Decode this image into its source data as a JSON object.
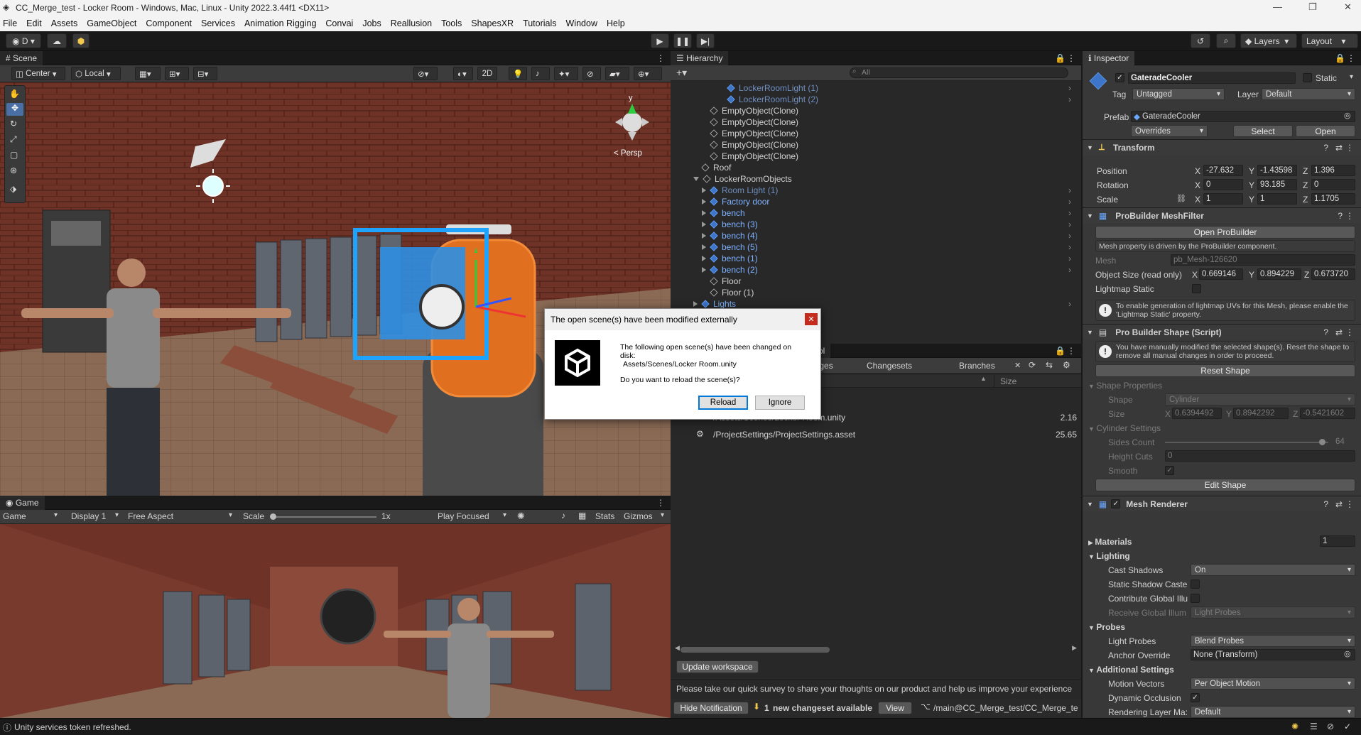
{
  "window": {
    "title": "CC_Merge_test - Locker Room - Windows, Mac, Linux - Unity 2022.3.44f1 <DX11>"
  },
  "menu": [
    "File",
    "Edit",
    "Assets",
    "GameObject",
    "Component",
    "Services",
    "Animation Rigging",
    "Convai",
    "Jobs",
    "Reallusion",
    "Tools",
    "ShapesXR",
    "Tutorials",
    "Window",
    "Help"
  ],
  "toolbar": {
    "account": "D",
    "layers": "Layers",
    "layout": "Layout"
  },
  "scene": {
    "tab": "Scene",
    "pivot": "Center",
    "space": "Local",
    "mode_2d": "2D",
    "persp": "< Persp",
    "gizmo_y": "y"
  },
  "game": {
    "tab": "Game",
    "view": "Game",
    "display": "Display 1",
    "aspect": "Free Aspect",
    "scale_label": "Scale",
    "scale_value": "1x",
    "play_mode": "Play Focused",
    "stats": "Stats",
    "gizmos": "Gizmos"
  },
  "hierarchy": {
    "tab": "Hierarchy",
    "search_placeholder": "All",
    "rows": [
      {
        "label": "LockerRoomLight (1)",
        "indent": 4,
        "style": "dim",
        "arrow": "",
        "icon": "prefab"
      },
      {
        "label": "LockerRoomLight (2)",
        "indent": 4,
        "style": "dim",
        "arrow": "",
        "icon": "prefab"
      },
      {
        "label": "EmptyObject(Clone)",
        "indent": 2,
        "style": "",
        "arrow": "",
        "icon": "object"
      },
      {
        "label": "EmptyObject(Clone)",
        "indent": 2,
        "style": "",
        "arrow": "",
        "icon": "object"
      },
      {
        "label": "EmptyObject(Clone)",
        "indent": 2,
        "style": "",
        "arrow": "",
        "icon": "object"
      },
      {
        "label": "EmptyObject(Clone)",
        "indent": 2,
        "style": "",
        "arrow": "",
        "icon": "object"
      },
      {
        "label": "EmptyObject(Clone)",
        "indent": 2,
        "style": "",
        "arrow": "",
        "icon": "object"
      },
      {
        "label": "Roof",
        "indent": 1,
        "style": "",
        "arrow": "",
        "icon": "object"
      },
      {
        "label": "LockerRoomObjects",
        "indent": 1,
        "style": "",
        "arrow": "down",
        "icon": "object"
      },
      {
        "label": "Room Light (1)",
        "indent": 2,
        "style": "dim",
        "arrow": "right",
        "icon": "prefab"
      },
      {
        "label": "Factory door",
        "indent": 2,
        "style": "blue",
        "arrow": "right",
        "icon": "prefab"
      },
      {
        "label": "bench",
        "indent": 2,
        "style": "blue",
        "arrow": "right",
        "icon": "prefab"
      },
      {
        "label": "bench (3)",
        "indent": 2,
        "style": "blue",
        "arrow": "right",
        "icon": "prefab"
      },
      {
        "label": "bench (4)",
        "indent": 2,
        "style": "blue",
        "arrow": "right",
        "icon": "prefab"
      },
      {
        "label": "bench (5)",
        "indent": 2,
        "style": "blue",
        "arrow": "right",
        "icon": "prefab"
      },
      {
        "label": "bench (1)",
        "indent": 2,
        "style": "blue",
        "arrow": "right",
        "icon": "prefab"
      },
      {
        "label": "bench (2)",
        "indent": 2,
        "style": "blue",
        "arrow": "right",
        "icon": "prefab"
      },
      {
        "label": "Floor",
        "indent": 2,
        "style": "",
        "arrow": "",
        "icon": "object"
      },
      {
        "label": "Floor (1)",
        "indent": 2,
        "style": "",
        "arrow": "",
        "icon": "object"
      },
      {
        "label": "Lights",
        "indent": 1,
        "style": "blue",
        "arrow": "right",
        "icon": "prefab"
      }
    ]
  },
  "plastic": {
    "tab_partial": "rol",
    "tabs": [
      "anges",
      "Changesets",
      "Branches"
    ],
    "col_size": "Size",
    "files": [
      {
        "path": "/Assets/Scenes/Locker Room.unity",
        "size": "2.16"
      },
      {
        "path": "/ProjectSettings/ProjectSettings.asset",
        "size": "25.65"
      }
    ],
    "update_button": "Update workspace",
    "survey": "Please take our quick survey to share your thoughts on our product and help us improve your experience",
    "hide_notification": "Hide Notification",
    "changeset_count": "1",
    "changeset_text": "new changeset available",
    "view_button": "View",
    "branch": "/main@CC_Merge_test/CC_Merge_te"
  },
  "inspector": {
    "tab": "Inspector",
    "object_name": "GateradeCooler",
    "static_label": "Static",
    "tag_label": "Tag",
    "tag": "Untagged",
    "layer_label": "Layer",
    "layer": "Default",
    "prefab_label": "Prefab",
    "prefab": "GateradeCooler",
    "overrides": "Overrides",
    "select": "Select",
    "open": "Open",
    "transform": {
      "title": "Transform",
      "position_label": "Position",
      "position": {
        "x": "-27.632",
        "y": "-1.43598",
        "z": "1.396"
      },
      "rotation_label": "Rotation",
      "rotation": {
        "x": "0",
        "y": "93.185",
        "z": "0"
      },
      "scale_label": "Scale",
      "scale": {
        "x": "1",
        "y": "1",
        "z": "1.1705"
      }
    },
    "meshfilter": {
      "title": "ProBuilder MeshFilter",
      "open_button": "Open ProBuilder",
      "note": "Mesh property is driven by the ProBuilder component.",
      "mesh_label": "Mesh",
      "mesh": "pb_Mesh-126620",
      "size_label": "Object Size (read only)",
      "size": {
        "x": "0.669146",
        "y": "0.894229",
        "z": "0.673720"
      },
      "lightmap_label": "Lightmap Static",
      "info": "To enable generation of lightmap UVs for this Mesh, please enable the 'Lightmap Static' property."
    },
    "shape": {
      "title": "Pro Builder Shape (Script)",
      "info": "You have manually modified the selected shape(s). Reset the shape to remove all manual changes in order to proceed.",
      "reset_button": "Reset Shape",
      "props_label": "Shape Properties",
      "shape_label": "Shape",
      "shape": "Cylinder",
      "size_label": "Size",
      "size": {
        "x": "0.6394492",
        "y": "0.8942292",
        "z": "-0.5421602"
      },
      "cyl_label": "Cylinder Settings",
      "sides_label": "Sides Count",
      "sides": "64",
      "sides_fraction": 0.98,
      "height_cuts_label": "Height Cuts",
      "height_cuts": "0",
      "smooth_label": "Smooth",
      "edit_button": "Edit Shape"
    },
    "renderer": {
      "title": "Mesh Renderer",
      "materials_label": "Materials",
      "materials_count": "1",
      "lighting_label": "Lighting",
      "cast_shadows_label": "Cast Shadows",
      "cast_shadows": "On",
      "static_shadow_label": "Static Shadow Caste",
      "contribute_gi_label": "Contribute Global Illu",
      "receive_gi_label": "Receive Global Illum",
      "receive_gi": "Light Probes",
      "probes_label": "Probes",
      "light_probes_label": "Light Probes",
      "light_probes": "Blend Probes",
      "anchor_label": "Anchor Override",
      "anchor": "None (Transform)",
      "additional_label": "Additional Settings",
      "motion_label": "Motion Vectors",
      "motion": "Per Object Motion",
      "dynamic_occ_label": "Dynamic Occlusion",
      "render_layer_label": "Rendering Layer Ma:",
      "render_layer": "Default"
    }
  },
  "dialog": {
    "title": "The open scene(s) have been modified externally",
    "line1": "The following open scene(s) have been changed on",
    "line2": "disk:",
    "path": "Assets/Scenes/Locker Room.unity",
    "question": "Do you want to reload the scene(s)?",
    "reload": "Reload",
    "ignore": "Ignore"
  },
  "status": {
    "message": "Unity services token refreshed."
  },
  "colors": {
    "accent": "#3d75c9",
    "orange": "#e8742a",
    "brick": "#7a3a2e"
  }
}
